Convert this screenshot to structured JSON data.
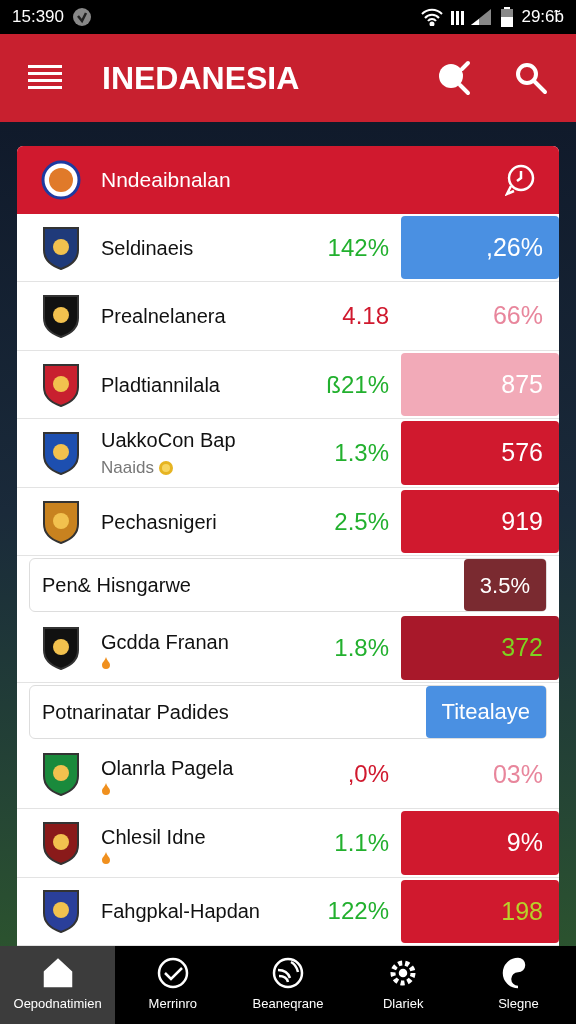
{
  "status_bar": {
    "time": "15:390",
    "right_time": "29:6̃b"
  },
  "app_bar": {
    "title": "INEDANESIA"
  },
  "card": {
    "title": "Nndeaibnalan"
  },
  "rows": [
    {
      "kind": "team",
      "name": "Seldinaeis",
      "color": "#1f3a7a",
      "pct": {
        "text": "142%",
        "color": "#22b02e"
      },
      "value": {
        "text": ",26%",
        "color": "#ffffff"
      },
      "cell": {
        "color": "#4a90e2"
      }
    },
    {
      "kind": "team",
      "name": "Prealnelanera",
      "color": "#111111",
      "pct": {
        "text": "4.18",
        "color": "#d0192e"
      },
      "value": {
        "text": "66%",
        "color": "#e8869c"
      },
      "cell": {
        "color": "#ffffff"
      }
    },
    {
      "kind": "team",
      "name": "Pladtiannilala",
      "color": "#c8202f",
      "pct": {
        "text": "ß21%",
        "color": "#22b02e"
      },
      "value": {
        "text": "875",
        "color": "#ffffff"
      },
      "cell": {
        "color": "#f2aab8"
      }
    },
    {
      "kind": "team",
      "name": "UakkoCon Bap",
      "subtitle": "Naaids",
      "color": "#1d4fb0",
      "pct": {
        "text": "1.3%",
        "color": "#22b02e"
      },
      "value": {
        "text": "576",
        "color": "#ffffff"
      },
      "cell": {
        "color": "#d0192e"
      }
    },
    {
      "kind": "team",
      "name": "Pechasnigeri",
      "color": "#c8821f",
      "pct": {
        "text": "2.5%",
        "color": "#22b02e"
      },
      "value": {
        "text": "919",
        "color": "#ffffff"
      },
      "cell": {
        "color": "#d0192e"
      }
    },
    {
      "kind": "section",
      "name": "Pen& Hisngarwe",
      "tag": {
        "text": "3.5%",
        "color": "#7a2a30"
      }
    },
    {
      "kind": "team",
      "name": "Gcdda Franan",
      "marked": true,
      "color": "#111111",
      "pct": {
        "text": "1.8%",
        "color": "#22b02e"
      },
      "value": {
        "text": "372",
        "color": "#7ed321"
      },
      "cell": {
        "color": "#a8182a"
      }
    },
    {
      "kind": "section",
      "name": "Potnarinatar Padides",
      "tag": {
        "text": "Titealaye",
        "color": "#4a90e2"
      }
    },
    {
      "kind": "team",
      "name": "Olanrla Pagela",
      "marked": true,
      "color": "#1a8a3c",
      "pct": {
        "text": ",0%",
        "color": "#d0192e"
      },
      "value": {
        "text": "03%",
        "color": "#e8869c"
      },
      "cell": {
        "color": "#ffffff"
      }
    },
    {
      "kind": "team",
      "name": "Chlesil Idne",
      "marked": true,
      "color": "#8a1a1a",
      "pct": {
        "text": "1.1%",
        "color": "#22b02e"
      },
      "value": {
        "text": "9%",
        "color": "#ffffff"
      },
      "cell": {
        "color": "#d0192e"
      }
    },
    {
      "kind": "team",
      "name": "Fahgpkal-Hapdan",
      "color": "#2a3f9a",
      "pct": {
        "text": "122%",
        "color": "#22b02e"
      },
      "value": {
        "text": "198",
        "color": "#b8d12a"
      },
      "cell": {
        "color": "#d0192e"
      }
    }
  ],
  "nav": [
    {
      "label": "Oepodnatimien",
      "selected": true
    },
    {
      "label": "Merrinro",
      "selected": false
    },
    {
      "label": "Beaneqrane",
      "selected": false
    },
    {
      "label": "Dlariek",
      "selected": false
    },
    {
      "label": "Slegne",
      "selected": false
    }
  ]
}
